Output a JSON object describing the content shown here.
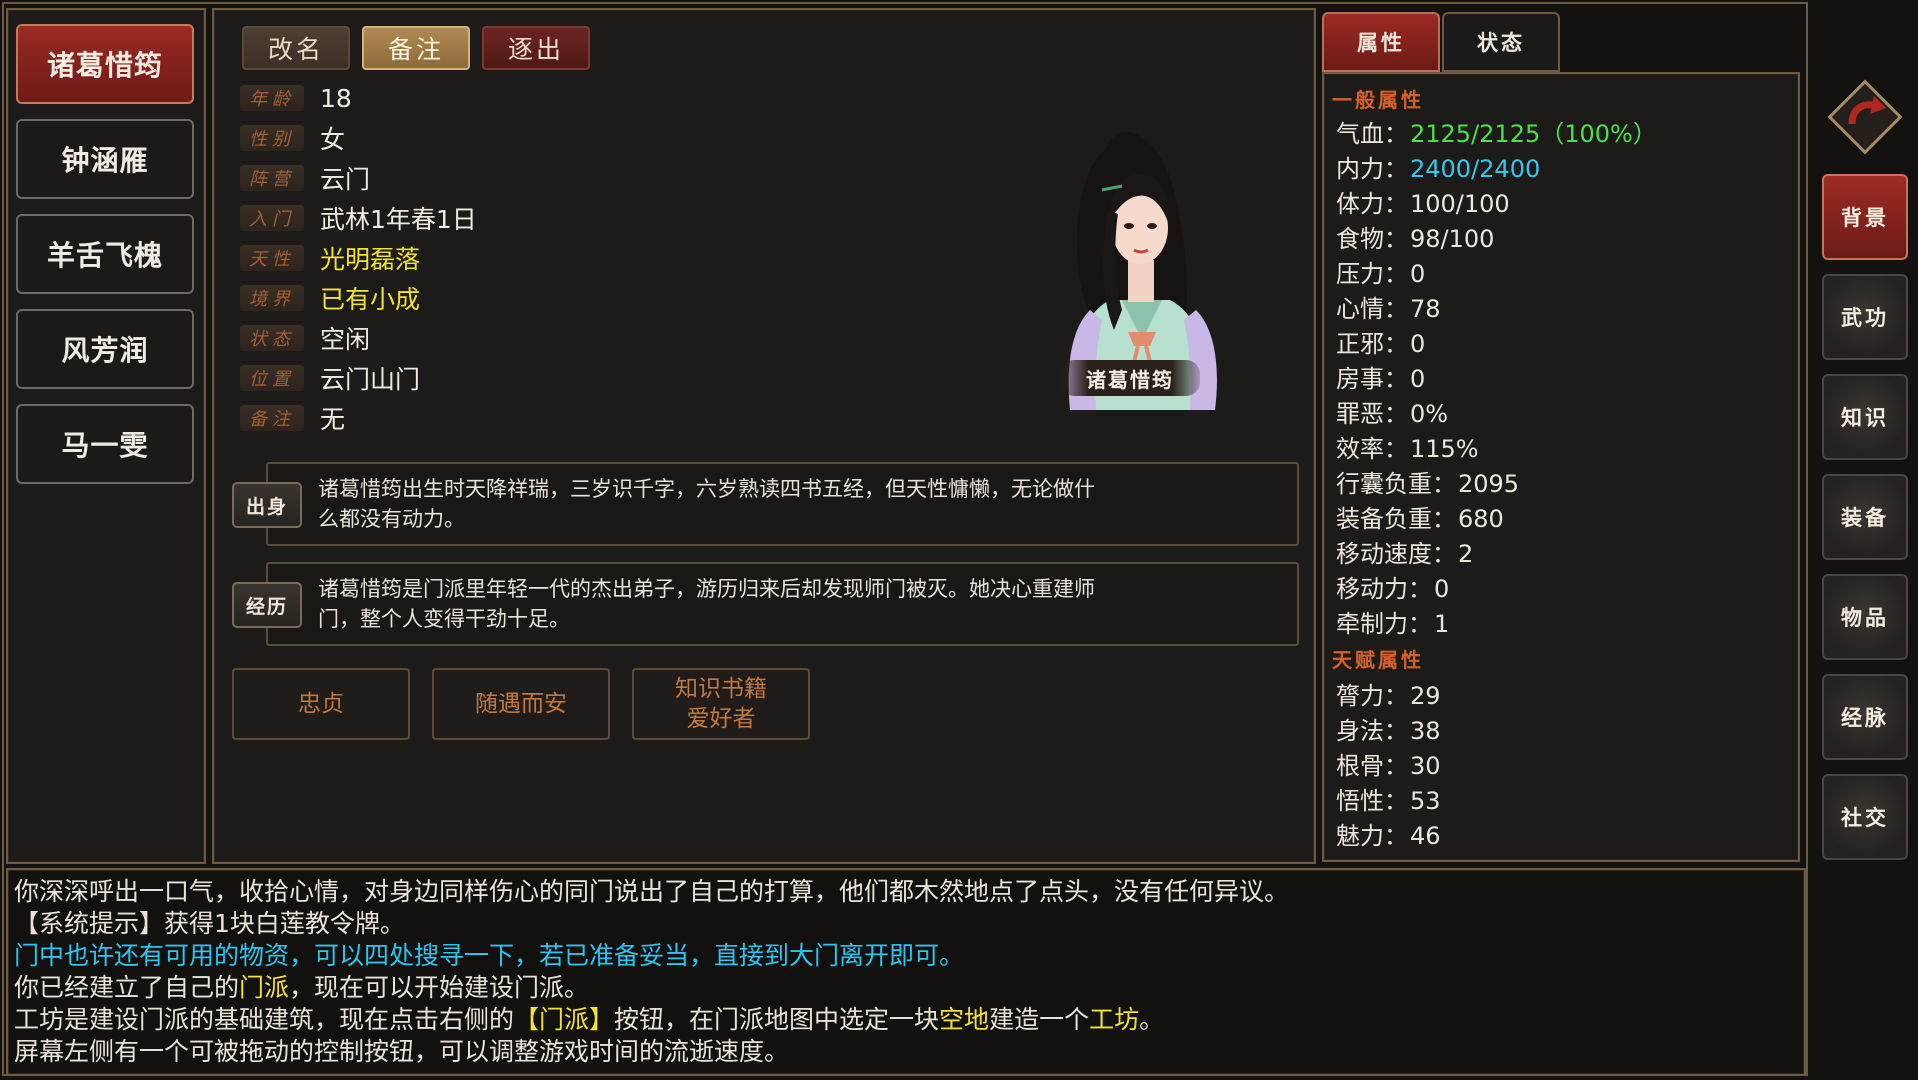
{
  "characters": [
    "诸葛惜筠",
    "钟涵雁",
    "羊舌飞槐",
    "风芳润",
    "马一雯"
  ],
  "actions": {
    "rename": "改名",
    "note": "备注",
    "expel": "逐出"
  },
  "info": [
    {
      "label": "年龄",
      "value": "18"
    },
    {
      "label": "性别",
      "value": "女"
    },
    {
      "label": "阵营",
      "value": "云门"
    },
    {
      "label": "入门",
      "value": "武林1年春1日"
    },
    {
      "label": "天性",
      "value": "光明磊落"
    },
    {
      "label": "境界",
      "value": "已有小成"
    },
    {
      "label": "状态",
      "value": "空闲"
    },
    {
      "label": "位置",
      "value": "云门山门"
    },
    {
      "label": "备注",
      "value": "无"
    }
  ],
  "portrait": {
    "name": "诸葛惜筠"
  },
  "origin": {
    "tag": "出身",
    "line1": "诸葛惜筠出生时天降祥瑞，三岁识千字，六岁熟读四书五经，但天性慵懒，无论做什",
    "line2": "么都没有动力。"
  },
  "experience": {
    "tag": "经历",
    "line1": "诸葛惜筠是门派里年轻一代的杰出弟子，游历归来后却发现师门被灭。她决心重建师",
    "line2": "门，整个人变得干劲十足。"
  },
  "traits": {
    "t1": "忠贞",
    "t2": "随遇而安",
    "t3a": "知识书籍",
    "t3b": "爱好者"
  },
  "tabs": {
    "attributes": "属性",
    "status": "状态"
  },
  "general_header": "一般属性",
  "talent_header": "天赋属性",
  "general": [
    {
      "k": "气血：",
      "v": "2125/2125（100%）",
      "color": "#4ce04c"
    },
    {
      "k": "内力：",
      "v": "2400/2400",
      "color": "#38c6f0"
    },
    {
      "k": "体力：",
      "v": "100/100"
    },
    {
      "k": "食物：",
      "v": "98/100"
    },
    {
      "k": "压力：",
      "v": "0"
    },
    {
      "k": "心情：",
      "v": "78"
    },
    {
      "k": "正邪：",
      "v": "0"
    },
    {
      "k": "房事：",
      "v": "0"
    },
    {
      "k": "罪恶：",
      "v": "0%"
    },
    {
      "k": "效率：",
      "v": "115%"
    },
    {
      "k": "行囊负重：",
      "v": "2095"
    },
    {
      "k": "装备负重：",
      "v": "680"
    },
    {
      "k": "移动速度：",
      "v": "2"
    },
    {
      "k": "移动力：",
      "v": "0"
    },
    {
      "k": "牵制力：",
      "v": "1"
    }
  ],
  "talent": [
    {
      "k": "膂力：",
      "v": "29"
    },
    {
      "k": "身法：",
      "v": "38"
    },
    {
      "k": "根骨：",
      "v": "30"
    },
    {
      "k": "悟性：",
      "v": "53"
    },
    {
      "k": "魅力：",
      "v": "46"
    }
  ],
  "side_nav": [
    "背景",
    "武功",
    "知识",
    "装备",
    "物品",
    "经脉",
    "社交"
  ],
  "log": {
    "l1": "你深深呼出一口气，收拾心情，对身边同样伤心的同门说出了自己的打算，他们都木然地点了点头，没有任何异议。",
    "l2": "【系统提示】获得1块白莲教令牌。",
    "l3": "门中也许还有可用的物资，可以四处搜寻一下，若已准备妥当，直接到大门离开即可。",
    "l4a": "你已经建立了自己的",
    "l4b": "门派",
    "l4c": "，现在可以开始建设门派。",
    "l5a": "工坊是建设门派的基础建筑，现在点击右侧的",
    "l5b": "【门派】",
    "l5c": "按钮，在门派地图中选定一块",
    "l5d": "空地",
    "l5e": "建造一个",
    "l5f": "工坊",
    "l5g": "。",
    "l6": "屏幕左侧有一个可被拖动的控制按钮，可以调整游戏时间的流逝速度。"
  },
  "colors": {
    "accent_red": "#8e2620",
    "gold": "#8a7350",
    "yellow": "#f1e336",
    "cyan": "#2fc4f0",
    "green": "#4ce04c"
  }
}
